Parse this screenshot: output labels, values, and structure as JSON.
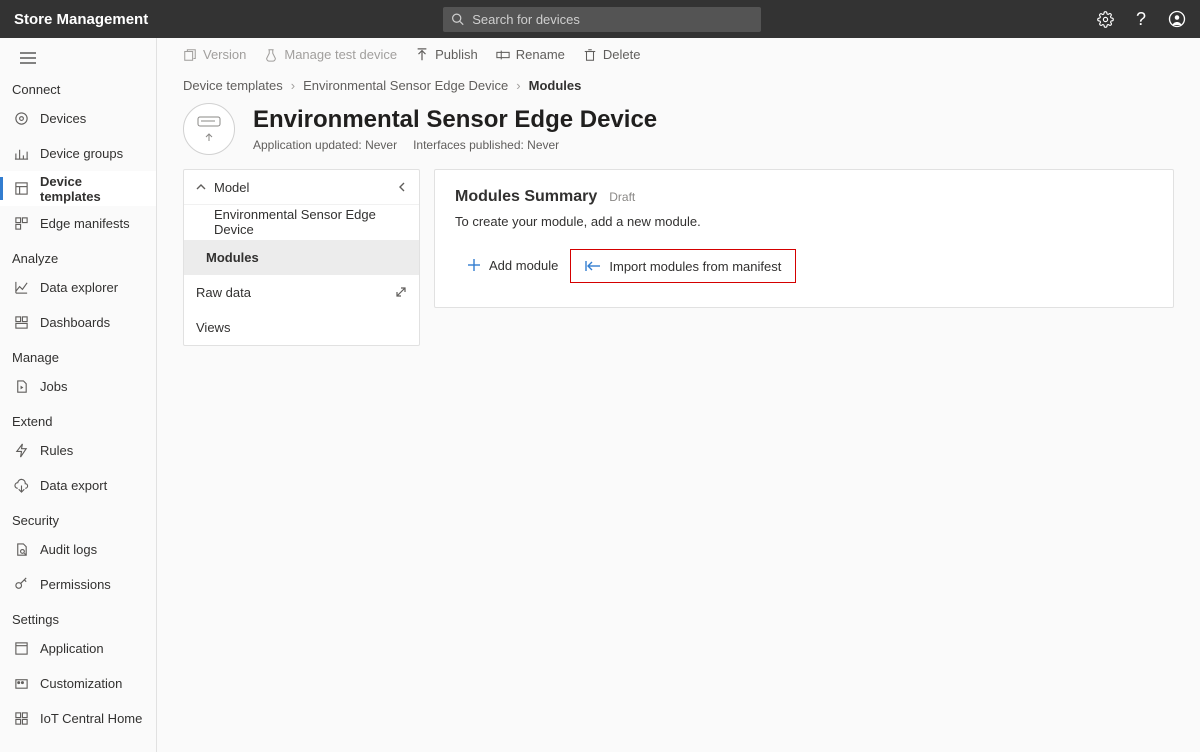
{
  "app": {
    "title": "Store Management"
  },
  "search": {
    "placeholder": "Search for devices"
  },
  "sidebar": {
    "sections": [
      {
        "label": "Connect",
        "items": [
          {
            "label": "Devices",
            "icon": "devices"
          },
          {
            "label": "Device groups",
            "icon": "barchart"
          },
          {
            "label": "Device templates",
            "icon": "template",
            "active": true
          },
          {
            "label": "Edge manifests",
            "icon": "puzzle"
          }
        ]
      },
      {
        "label": "Analyze",
        "items": [
          {
            "label": "Data explorer",
            "icon": "linechart"
          },
          {
            "label": "Dashboards",
            "icon": "dashboard"
          }
        ]
      },
      {
        "label": "Manage",
        "items": [
          {
            "label": "Jobs",
            "icon": "file-play"
          }
        ]
      },
      {
        "label": "Extend",
        "items": [
          {
            "label": "Rules",
            "icon": "bolt"
          },
          {
            "label": "Data export",
            "icon": "cloud-out"
          }
        ]
      },
      {
        "label": "Security",
        "items": [
          {
            "label": "Audit logs",
            "icon": "doc-search"
          },
          {
            "label": "Permissions",
            "icon": "key"
          }
        ]
      },
      {
        "label": "Settings",
        "items": [
          {
            "label": "Application",
            "icon": "app-grid"
          },
          {
            "label": "Customization",
            "icon": "palette"
          },
          {
            "label": "IoT Central Home",
            "icon": "home"
          }
        ]
      }
    ]
  },
  "toolbar": {
    "version": "Version",
    "manage_test": "Manage test device",
    "publish": "Publish",
    "rename": "Rename",
    "delete": "Delete"
  },
  "breadcrumb": {
    "a": "Device templates",
    "b": "Environmental Sensor Edge Device",
    "c": "Modules"
  },
  "page": {
    "title": "Environmental Sensor Edge Device",
    "meta_updated": "Application updated: Never",
    "meta_published": "Interfaces published: Never"
  },
  "tree": {
    "model": "Model",
    "root": "Environmental Sensor Edge Device",
    "modules": "Modules",
    "rawdata": "Raw data",
    "views": "Views"
  },
  "panel": {
    "title": "Modules Summary",
    "status": "Draft",
    "help": "To create your module, add a new module.",
    "add": "Add module",
    "import": "Import modules from manifest"
  }
}
